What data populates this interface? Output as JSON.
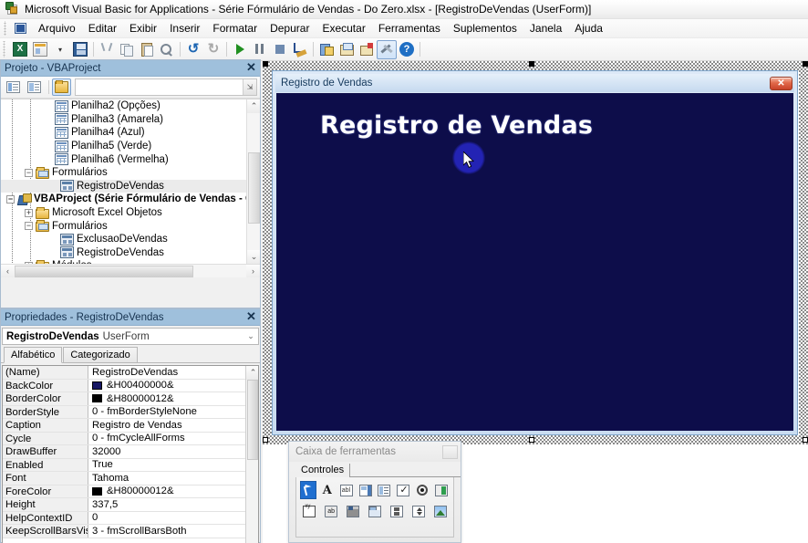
{
  "window": {
    "title": "Microsoft Visual Basic for Applications - Série Fórmulário de Vendas - Do Zero.xlsx - [RegistroDeVendas (UserForm)]",
    "app_icon": "vba-app-icon"
  },
  "menubar": {
    "items": [
      {
        "label": "Arquivo",
        "accel": "A"
      },
      {
        "label": "Editar",
        "accel": "E"
      },
      {
        "label": "Exibir",
        "accel": "b"
      },
      {
        "label": "Inserir",
        "accel": "I"
      },
      {
        "label": "Formatar",
        "accel": "o"
      },
      {
        "label": "Depurar",
        "accel": "D"
      },
      {
        "label": "Executar",
        "accel": "x"
      },
      {
        "label": "Ferramentas",
        "accel": "F"
      },
      {
        "label": "Suplementos",
        "accel": "S"
      },
      {
        "label": "Janela",
        "accel": "J"
      },
      {
        "label": "Ajuda",
        "accel": "u"
      }
    ]
  },
  "toolbar": {
    "buttons": [
      {
        "name": "view-excel-button",
        "icon": "excel-icon",
        "active": false
      },
      {
        "name": "insert-userform-button",
        "icon": "userform-icon",
        "active": false
      },
      {
        "name": "insert-dropdown-button",
        "icon": "chevron-down-icon",
        "active": false
      },
      {
        "name": "save-button",
        "icon": "save-icon",
        "active": false
      },
      {
        "name": "cut-button",
        "icon": "scissors-icon",
        "active": false
      },
      {
        "name": "copy-button",
        "icon": "copy-icon",
        "active": false
      },
      {
        "name": "paste-button",
        "icon": "paste-icon",
        "active": false
      },
      {
        "name": "find-button",
        "icon": "binoculars-icon",
        "active": false
      },
      {
        "name": "undo-button",
        "icon": "undo-arrow-icon",
        "active": false
      },
      {
        "name": "redo-button",
        "icon": "redo-arrow-icon",
        "active": false
      },
      {
        "name": "run-button",
        "icon": "play-triangle-icon",
        "active": false
      },
      {
        "name": "break-button",
        "icon": "pause-icon",
        "active": false
      },
      {
        "name": "reset-button",
        "icon": "stop-square-icon",
        "active": false
      },
      {
        "name": "design-mode-button",
        "icon": "design-ruler-icon",
        "active": false
      },
      {
        "name": "project-explorer-button",
        "icon": "project-explorer-icon",
        "active": false
      },
      {
        "name": "properties-window-button",
        "icon": "properties-window-icon",
        "active": false
      },
      {
        "name": "object-browser-button",
        "icon": "object-browser-icon",
        "active": false
      },
      {
        "name": "toolbox-button",
        "icon": "toolbox-wrench-icon",
        "active": true
      },
      {
        "name": "help-button",
        "icon": "question-mark-icon",
        "active": false
      }
    ]
  },
  "project_panel": {
    "title": "Projeto - VBAProject",
    "close_label": "✕",
    "toolbar": [
      {
        "name": "view-code-button",
        "icon": "view-code-icon",
        "selected": false
      },
      {
        "name": "view-object-button",
        "icon": "view-object-icon",
        "selected": false
      },
      {
        "name": "toggle-folders-button",
        "icon": "folder-icon",
        "selected": true
      }
    ],
    "tree": [
      {
        "label": "Planilha2 (Opções)",
        "indent": 46,
        "icon": "worksheet-icon",
        "expander": "",
        "bold": false,
        "selected": false
      },
      {
        "label": "Planilha3 (Amarela)",
        "indent": 46,
        "icon": "worksheet-icon",
        "expander": "",
        "bold": false,
        "selected": false
      },
      {
        "label": "Planilha4 (Azul)",
        "indent": 46,
        "icon": "worksheet-icon",
        "expander": "",
        "bold": false,
        "selected": false
      },
      {
        "label": "Planilha5 (Verde)",
        "indent": 46,
        "icon": "worksheet-icon",
        "expander": "",
        "bold": false,
        "selected": false
      },
      {
        "label": "Planilha6 (Vermelha)",
        "indent": 46,
        "icon": "worksheet-icon",
        "expander": "",
        "bold": false,
        "selected": false
      },
      {
        "label": "Formulários",
        "indent": 26,
        "icon": "forms-folder-icon",
        "expander": "−",
        "bold": false,
        "selected": false
      },
      {
        "label": "RegistroDeVendas",
        "indent": 52,
        "icon": "userform-node-icon",
        "expander": "",
        "bold": false,
        "selected": true
      },
      {
        "label": "VBAProject (Série Fórmulário de Vendas - Ga",
        "indent": 6,
        "icon": "vbaproject-icon",
        "expander": "−",
        "bold": true,
        "selected": false
      },
      {
        "label": "Microsoft Excel Objetos",
        "indent": 26,
        "icon": "folder-icon",
        "expander": "+",
        "bold": false,
        "selected": false
      },
      {
        "label": "Formulários",
        "indent": 26,
        "icon": "forms-folder-icon",
        "expander": "−",
        "bold": false,
        "selected": false
      },
      {
        "label": "ExclusaoDeVendas",
        "indent": 52,
        "icon": "userform-node-icon",
        "expander": "",
        "bold": false,
        "selected": false
      },
      {
        "label": "RegistroDeVendas",
        "indent": 52,
        "icon": "userform-node-icon",
        "expander": "",
        "bold": false,
        "selected": false
      },
      {
        "label": "Módulos",
        "indent": 26,
        "icon": "folder-icon",
        "expander": "+",
        "bold": false,
        "selected": false
      }
    ],
    "scroll_up": "⌃",
    "scroll_down": "⌄",
    "scroll_left": "‹",
    "scroll_right": "›"
  },
  "properties_panel": {
    "title": "Propriedades - RegistroDeVendas",
    "close_label": "✕",
    "object_name": "RegistroDeVendas",
    "object_type": "UserForm",
    "dropdown_arrow": "⌄",
    "tabs": [
      {
        "label": "Alfabético",
        "active": true
      },
      {
        "label": "Categorizado",
        "active": false
      }
    ],
    "rows": [
      {
        "key": "(Name)",
        "value": "RegistroDeVendas",
        "swatch": null
      },
      {
        "key": "BackColor",
        "value": "&H00400000&",
        "swatch": "#171764"
      },
      {
        "key": "BorderColor",
        "value": "&H80000012&",
        "swatch": "#000000"
      },
      {
        "key": "BorderStyle",
        "value": "0 - fmBorderStyleNone",
        "swatch": null
      },
      {
        "key": "Caption",
        "value": "Registro de Vendas",
        "swatch": null
      },
      {
        "key": "Cycle",
        "value": "0 - fmCycleAllForms",
        "swatch": null
      },
      {
        "key": "DrawBuffer",
        "value": "32000",
        "swatch": null
      },
      {
        "key": "Enabled",
        "value": "True",
        "swatch": null
      },
      {
        "key": "Font",
        "value": "Tahoma",
        "swatch": null
      },
      {
        "key": "ForeColor",
        "value": "&H80000012&",
        "swatch": "#000000"
      },
      {
        "key": "Height",
        "value": "337,5",
        "swatch": null
      },
      {
        "key": "HelpContextID",
        "value": "0",
        "swatch": null
      },
      {
        "key": "KeepScrollBarsVisible",
        "value": "3 - fmScrollBarsBoth",
        "swatch": null
      }
    ]
  },
  "userform": {
    "caption": "Registro de Vendas",
    "close_label": "✕",
    "heading": "Registro de Vendas",
    "back_color": "#0d0d4a",
    "heading_color": "#ffffff"
  },
  "toolbox": {
    "title": "Caixa de ferramentas",
    "tabs": [
      {
        "label": "Controles",
        "active": true
      }
    ],
    "controls_row1": [
      {
        "name": "select-objects-tool",
        "icon": "arrow-cursor-icon",
        "selected": true
      },
      {
        "name": "label-tool",
        "icon": "label-A-icon",
        "selected": false
      },
      {
        "name": "textbox-tool",
        "icon": "textbox-icon",
        "selected": false
      },
      {
        "name": "combobox-tool",
        "icon": "combobox-icon",
        "selected": false
      },
      {
        "name": "listbox-tool",
        "icon": "listbox-icon",
        "selected": false
      },
      {
        "name": "checkbox-tool",
        "icon": "checkbox-icon",
        "selected": false
      },
      {
        "name": "optionbutton-tool",
        "icon": "radio-button-icon",
        "selected": false
      },
      {
        "name": "togglebutton-tool",
        "icon": "toggle-button-icon",
        "selected": false
      }
    ],
    "controls_row2": [
      {
        "name": "frame-tool",
        "icon": "frame-icon",
        "selected": false
      },
      {
        "name": "commandbutton-tool",
        "icon": "command-button-icon",
        "selected": false
      },
      {
        "name": "tabstrip-tool",
        "icon": "tabstrip-icon",
        "selected": false
      },
      {
        "name": "multipage-tool",
        "icon": "multipage-icon",
        "selected": false
      },
      {
        "name": "scrollbar-tool",
        "icon": "scrollbar-icon",
        "selected": false
      },
      {
        "name": "spinbutton-tool",
        "icon": "spin-button-icon",
        "selected": false
      },
      {
        "name": "image-tool",
        "icon": "image-icon",
        "selected": false
      }
    ]
  }
}
